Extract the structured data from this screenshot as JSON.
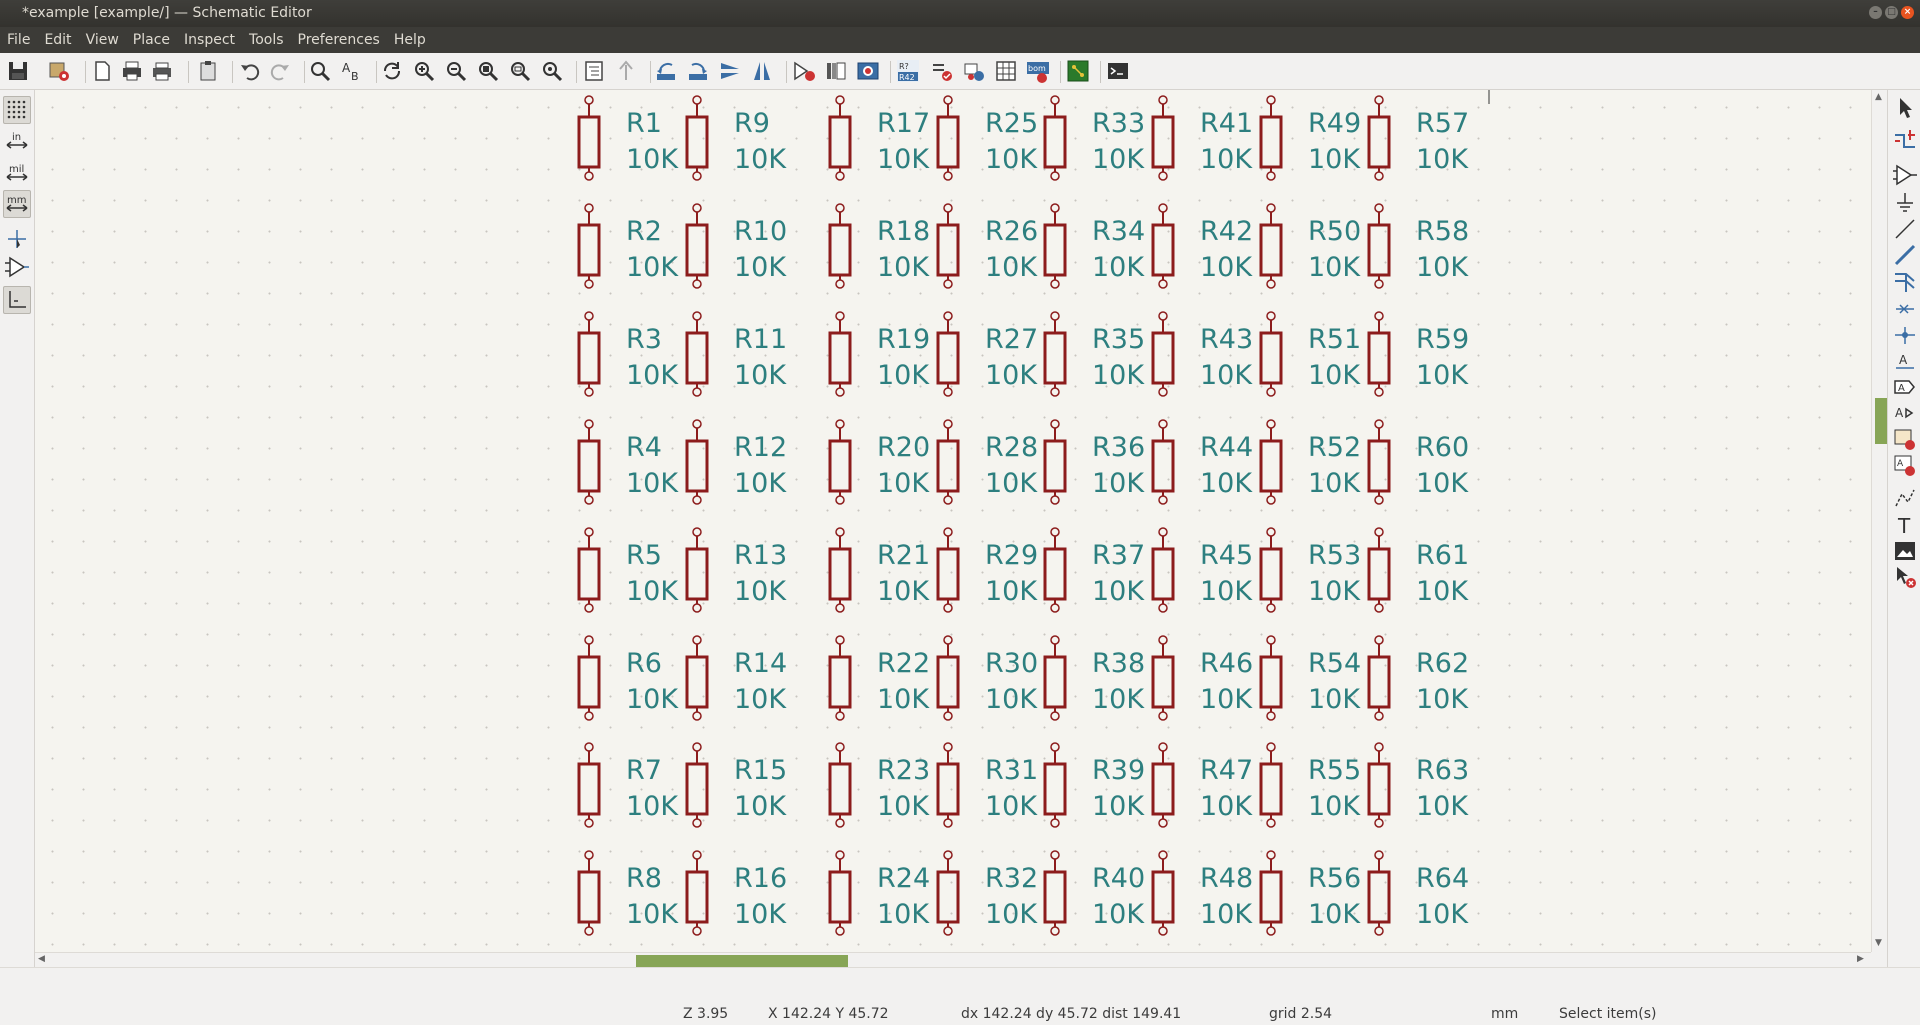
{
  "window": {
    "title": "*example [example/] — Schematic Editor",
    "buttons": {
      "minimize": "–",
      "maximize": "□",
      "close": "×"
    }
  },
  "menu": [
    "File",
    "Edit",
    "View",
    "Place",
    "Inspect",
    "Tools",
    "Preferences",
    "Help"
  ],
  "toolbar": {
    "icons": [
      "save-icon",
      "schematic-setup-icon",
      "page-settings-icon",
      "print-icon",
      "plot-icon",
      "paste-icon",
      "undo-icon",
      "redo-icon",
      "find-icon",
      "find-replace-icon",
      "refresh-icon",
      "zoom-in-icon",
      "zoom-out-icon",
      "zoom-fit-icon",
      "zoom-objects-icon",
      "zoom-selection-icon",
      "hierarchy-navigator-icon",
      "leave-sheet-icon",
      "rotate-ccw-icon",
      "rotate-cw-icon",
      "mirror-vertical-icon",
      "mirror-horizontal-icon",
      "symbol-editor-icon",
      "symbol-library-browser-icon",
      "update-pcb-icon",
      "annotate-icon",
      "erc-icon",
      "assign-footprints-icon",
      "edit-fields-table-icon",
      "bom-icon",
      "open-pcb-icon",
      "scripting-console-icon"
    ],
    "annotate_badge": {
      "top": "R?",
      "bottom": "R42"
    },
    "bom_badge": "bom"
  },
  "left_toolbar": {
    "items": [
      "grid-toggle",
      "units-inches",
      "units-mils",
      "units-millimeters",
      "cursor-style",
      "hidden-pins",
      "wire-45-mode"
    ],
    "labels": {
      "inches": "in",
      "mils": "mil",
      "millimeters": "mm"
    }
  },
  "right_toolbar": {
    "items": [
      "select-arrow",
      "highlight-net",
      "add-symbol",
      "add-power",
      "add-wire",
      "add-bus",
      "add-bus-entry",
      "add-no-connect",
      "add-junction",
      "add-net-label",
      "add-global-label",
      "add-hier-label",
      "add-sheet",
      "import-sheet-pin",
      "add-graphic-line",
      "add-text",
      "add-image",
      "delete-item"
    ]
  },
  "schematic": {
    "value": "10K",
    "columns": [
      [
        "R1",
        "R2",
        "R3",
        "R4",
        "R5",
        "R6",
        "R7",
        "R8"
      ],
      [
        "R9",
        "R10",
        "R11",
        "R12",
        "R13",
        "R14",
        "R15",
        "R16"
      ],
      [
        "R17",
        "R18",
        "R19",
        "R20",
        "R21",
        "R22",
        "R23",
        "R24"
      ],
      [
        "R25",
        "R26",
        "R27",
        "R28",
        "R29",
        "R30",
        "R31",
        "R32"
      ],
      [
        "R33",
        "R34",
        "R35",
        "R36",
        "R37",
        "R38",
        "R39",
        "R40"
      ],
      [
        "R41",
        "R42",
        "R43",
        "R44",
        "R45",
        "R46",
        "R47",
        "R48"
      ],
      [
        "R49",
        "R50",
        "R51",
        "R52",
        "R53",
        "R54",
        "R55",
        "R56"
      ],
      [
        "R57",
        "R58",
        "R59",
        "R60",
        "R61",
        "R62",
        "R63",
        "R64"
      ]
    ]
  },
  "status": {
    "zoom": "Z 3.95",
    "cursor": "X 142.24  Y 45.72",
    "delta": "dx 142.24  dy 45.72  dist 149.41",
    "grid": "grid 2.54",
    "units": "mm",
    "mode": "Select item(s)"
  },
  "colors": {
    "resistor": "#8c1c1c",
    "label": "#2d7f7f",
    "scroll_thumb": "#87a556",
    "background": "#f5f4ef"
  }
}
